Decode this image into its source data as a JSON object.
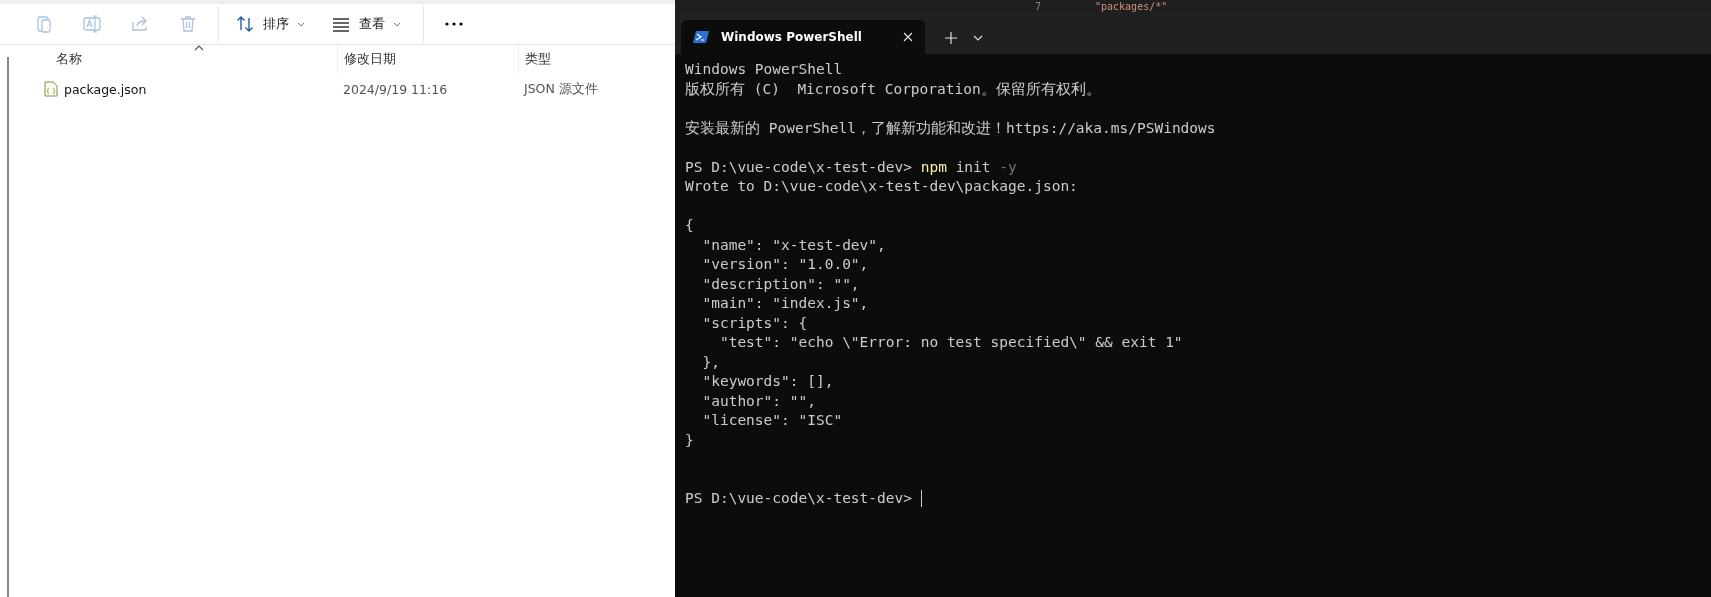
{
  "explorer": {
    "toolbar": [
      {
        "kind": "icon",
        "disabled": true
      },
      {
        "kind": "icon",
        "disabled": true
      },
      {
        "kind": "icon",
        "disabled": true
      },
      {
        "kind": "icon",
        "disabled": true
      },
      {
        "kind": "menu",
        "label": "排序"
      },
      {
        "kind": "menu",
        "label": "查看"
      },
      {
        "kind": "more"
      }
    ],
    "columns": [
      {
        "label": "名称",
        "sorted": true
      },
      {
        "label": "修改日期",
        "sorted": false
      },
      {
        "label": "类型",
        "sorted": false
      }
    ],
    "rows": [
      {
        "name": "package.json",
        "date": "2024/9/19 11:16",
        "type": "JSON 源文件",
        "selected": false
      }
    ]
  },
  "editor": {
    "line_number": "7",
    "code": "\"packages/*\""
  },
  "terminal": {
    "tabs": [
      {
        "title": "Windows PowerShell",
        "selected": true
      }
    ],
    "lines": [
      {
        "kind": "text",
        "parts": [
          {
            "kind": "plain",
            "text": "Windows PowerShell"
          }
        ]
      },
      {
        "kind": "text",
        "parts": [
          {
            "kind": "plain",
            "text": "版权所有 (C)  Microsoft Corporation。保留所有权利。"
          }
        ]
      },
      {
        "kind": "blank"
      },
      {
        "kind": "text",
        "parts": [
          {
            "kind": "plain",
            "text": "安装最新的 PowerShell，了解新功能和改进！https://aka.ms/PSWindows"
          }
        ]
      },
      {
        "kind": "blank"
      },
      {
        "kind": "text",
        "parts": [
          {
            "kind": "plain",
            "text": "PS D:\\vue-code\\x-test-dev> "
          },
          {
            "kind": "command",
            "text": "npm"
          },
          {
            "kind": "plain",
            "text": " init "
          },
          {
            "kind": "arg",
            "text": "-y"
          }
        ]
      },
      {
        "kind": "text",
        "parts": [
          {
            "kind": "plain",
            "text": "Wrote to D:\\vue-code\\x-test-dev\\package.json:"
          }
        ]
      },
      {
        "kind": "blank"
      },
      {
        "kind": "text",
        "parts": [
          {
            "kind": "plain",
            "text": "{"
          }
        ]
      },
      {
        "kind": "text",
        "parts": [
          {
            "kind": "plain",
            "text": "  \"name\": \"x-test-dev\","
          }
        ]
      },
      {
        "kind": "text",
        "parts": [
          {
            "kind": "plain",
            "text": "  \"version\": \"1.0.0\","
          }
        ]
      },
      {
        "kind": "text",
        "parts": [
          {
            "kind": "plain",
            "text": "  \"description\": \"\","
          }
        ]
      },
      {
        "kind": "text",
        "parts": [
          {
            "kind": "plain",
            "text": "  \"main\": \"index.js\","
          }
        ]
      },
      {
        "kind": "text",
        "parts": [
          {
            "kind": "plain",
            "text": "  \"scripts\": {"
          }
        ]
      },
      {
        "kind": "text",
        "parts": [
          {
            "kind": "plain",
            "text": "    \"test\": \"echo \\\"Error: no test specified\\\" && exit 1\""
          }
        ]
      },
      {
        "kind": "text",
        "parts": [
          {
            "kind": "plain",
            "text": "  },"
          }
        ]
      },
      {
        "kind": "text",
        "parts": [
          {
            "kind": "plain",
            "text": "  \"keywords\": [],"
          }
        ]
      },
      {
        "kind": "text",
        "parts": [
          {
            "kind": "plain",
            "text": "  \"author\": \"\","
          }
        ]
      },
      {
        "kind": "text",
        "parts": [
          {
            "kind": "plain",
            "text": "  \"license\": \"ISC\""
          }
        ]
      },
      {
        "kind": "text",
        "parts": [
          {
            "kind": "plain",
            "text": "}"
          }
        ]
      },
      {
        "kind": "blank"
      },
      {
        "kind": "blank"
      },
      {
        "kind": "text",
        "parts": [
          {
            "kind": "plain",
            "text": "PS D:\\vue-code\\x-test-dev> "
          }
        ],
        "cursor": true
      }
    ]
  }
}
